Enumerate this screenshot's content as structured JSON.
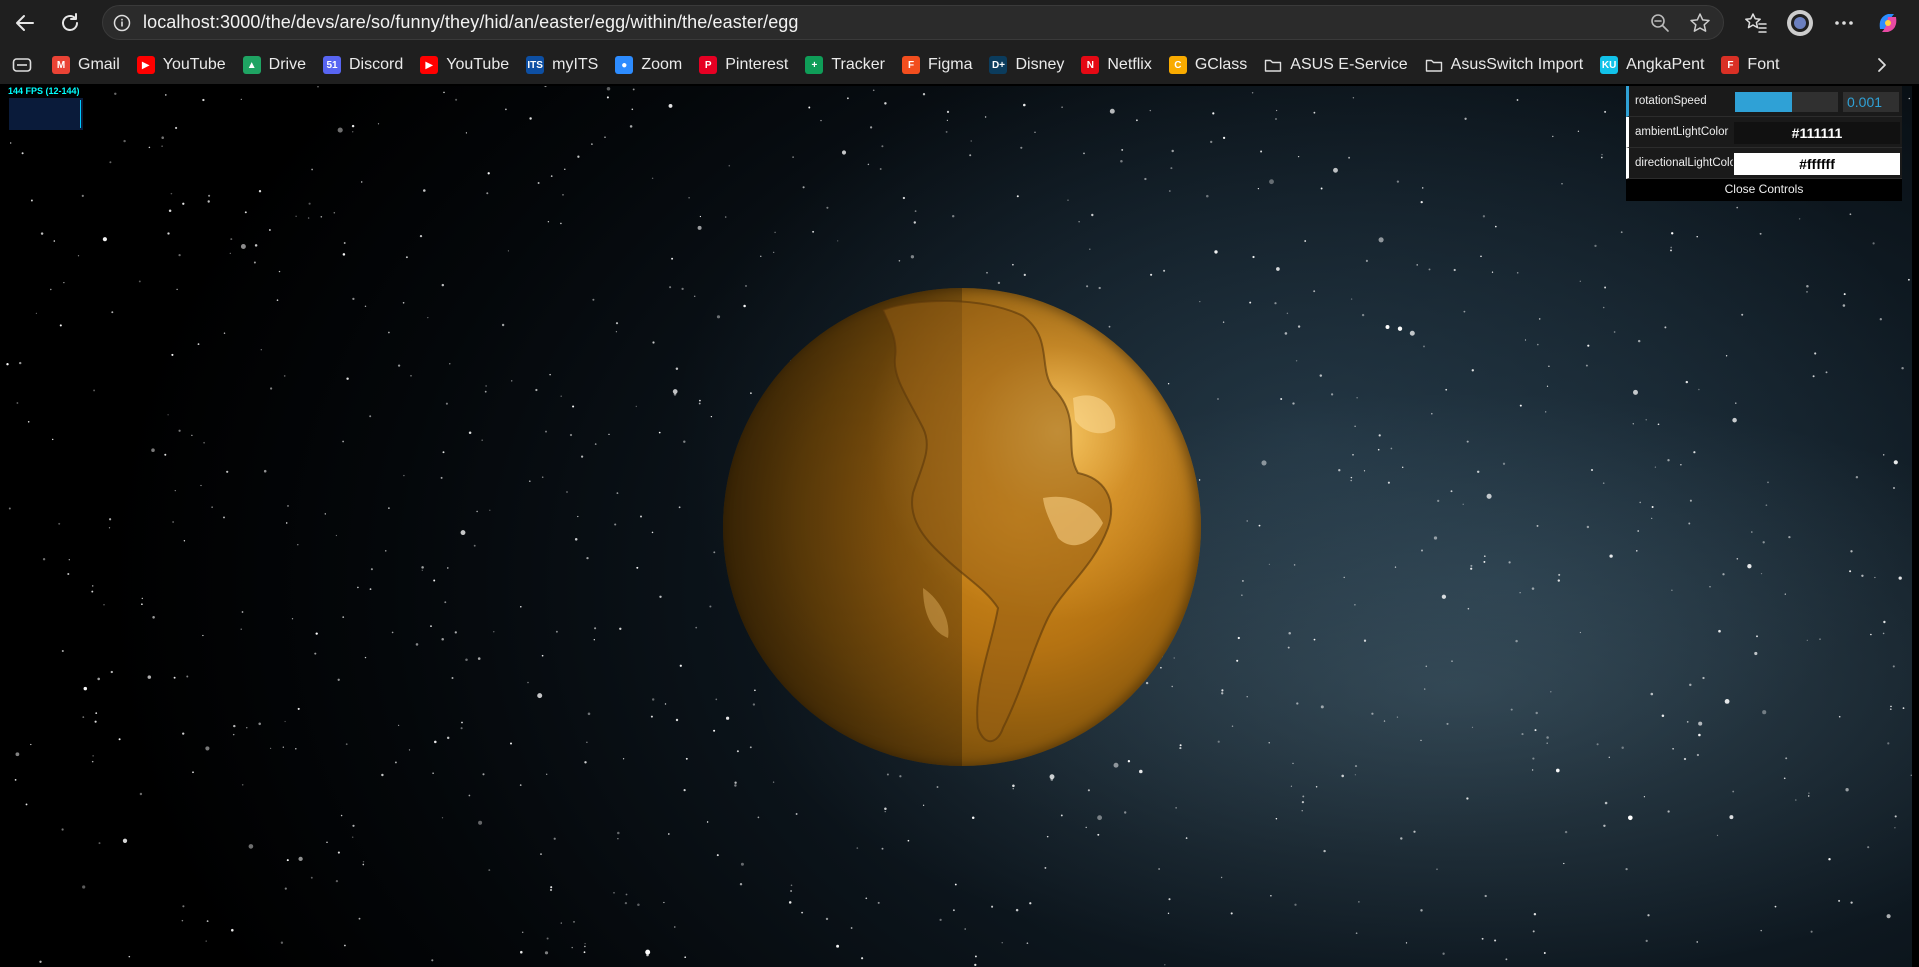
{
  "browser": {
    "url": "localhost:3000/the/devs/are/so/funny/they/hid/an/easter/egg/within/the/easter/egg",
    "bookmarks": [
      {
        "label": "Gmail",
        "icon": "gmail-icon",
        "color": "#ea4335"
      },
      {
        "label": "YouTube",
        "icon": "youtube-icon",
        "color": "#ff0000"
      },
      {
        "label": "Drive",
        "icon": "drive-icon",
        "color": "#1fa463"
      },
      {
        "label": "Discord",
        "icon": "discord-icon",
        "color": "#5865f2"
      },
      {
        "label": "YouTube",
        "icon": "youtube-icon",
        "color": "#ff0000"
      },
      {
        "label": "myITS",
        "icon": "myits-icon",
        "color": "#0d4fa3"
      },
      {
        "label": "Zoom",
        "icon": "zoom-icon",
        "color": "#2d8cff"
      },
      {
        "label": "Pinterest",
        "icon": "pinterest-icon",
        "color": "#e60023"
      },
      {
        "label": "Tracker",
        "icon": "sheets-icon",
        "color": "#0f9d58"
      },
      {
        "label": "Figma",
        "icon": "figma-icon",
        "color": "#f24e1e"
      },
      {
        "label": "Disney",
        "icon": "disney-icon",
        "color": "#0b3c5d"
      },
      {
        "label": "Netflix",
        "icon": "netflix-icon",
        "color": "#e50914"
      },
      {
        "label": "GClass",
        "icon": "classroom-icon",
        "color": "#f9ab00"
      },
      {
        "label": "ASUS E-Service",
        "icon": "folder-icon",
        "color": ""
      },
      {
        "label": "AsusSwitch Import",
        "icon": "folder-icon",
        "color": ""
      },
      {
        "label": "AngkaPent",
        "icon": "angkapent-icon",
        "color": "#12c2e9"
      },
      {
        "label": "Font",
        "icon": "font-icon",
        "color": "#d93025"
      }
    ]
  },
  "stats": {
    "fps_text": "144 FPS (12-144)"
  },
  "controls": {
    "rotation_speed": {
      "label": "rotationSpeed",
      "value": "0.001",
      "fill_fraction": 0.55
    },
    "ambient_light": {
      "label": "ambientLightColor",
      "value": "#111111"
    },
    "directional_light": {
      "label": "directionalLightColor",
      "value": "#ffffff"
    },
    "close_label": "Close Controls"
  },
  "colors": {
    "accent": "#2fa1d6",
    "planet": "#c98418"
  }
}
